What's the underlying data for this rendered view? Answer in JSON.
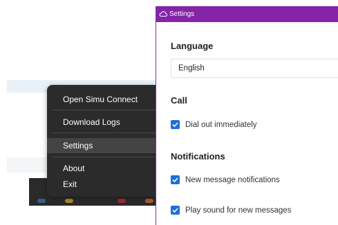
{
  "tray_menu": {
    "items": [
      {
        "label": "Open Simu Connect"
      },
      {
        "label": "Download Logs"
      },
      {
        "label": "Settings",
        "highlighted": true
      },
      {
        "label": "About"
      },
      {
        "label": "Exit"
      }
    ]
  },
  "settings": {
    "title": "Settings",
    "title_icon": "cloud-icon",
    "accent_color": "#8424a6",
    "checkbox_color": "#1e6fd9",
    "language": {
      "heading": "Language",
      "value": "English"
    },
    "call": {
      "heading": "Call",
      "dial_out": {
        "label": "Dial out immediately",
        "checked": true
      }
    },
    "notifications": {
      "heading": "Notifications",
      "new_message": {
        "label": "New message notifications",
        "checked": true
      },
      "play_sound": {
        "label": "Play sound for new messages",
        "checked": true
      }
    }
  }
}
